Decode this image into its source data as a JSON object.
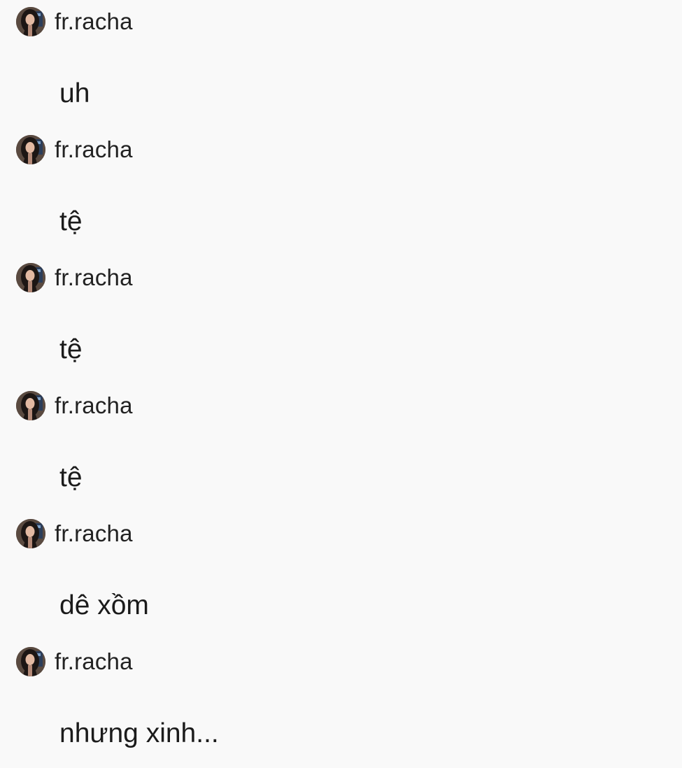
{
  "messages": [
    {
      "username": "fr.racha",
      "avatar": "profile-photo",
      "text": "uh"
    },
    {
      "username": "fr.racha",
      "avatar": "profile-photo",
      "text": "tệ"
    },
    {
      "username": "fr.racha",
      "avatar": "profile-photo",
      "text": "tệ"
    },
    {
      "username": "fr.racha",
      "avatar": "profile-photo",
      "text": "tệ"
    },
    {
      "username": "fr.racha",
      "avatar": "profile-photo",
      "text": "dê xồm"
    },
    {
      "username": "fr.racha",
      "avatar": "profile-photo",
      "text": "nhưng xinh..."
    }
  ]
}
